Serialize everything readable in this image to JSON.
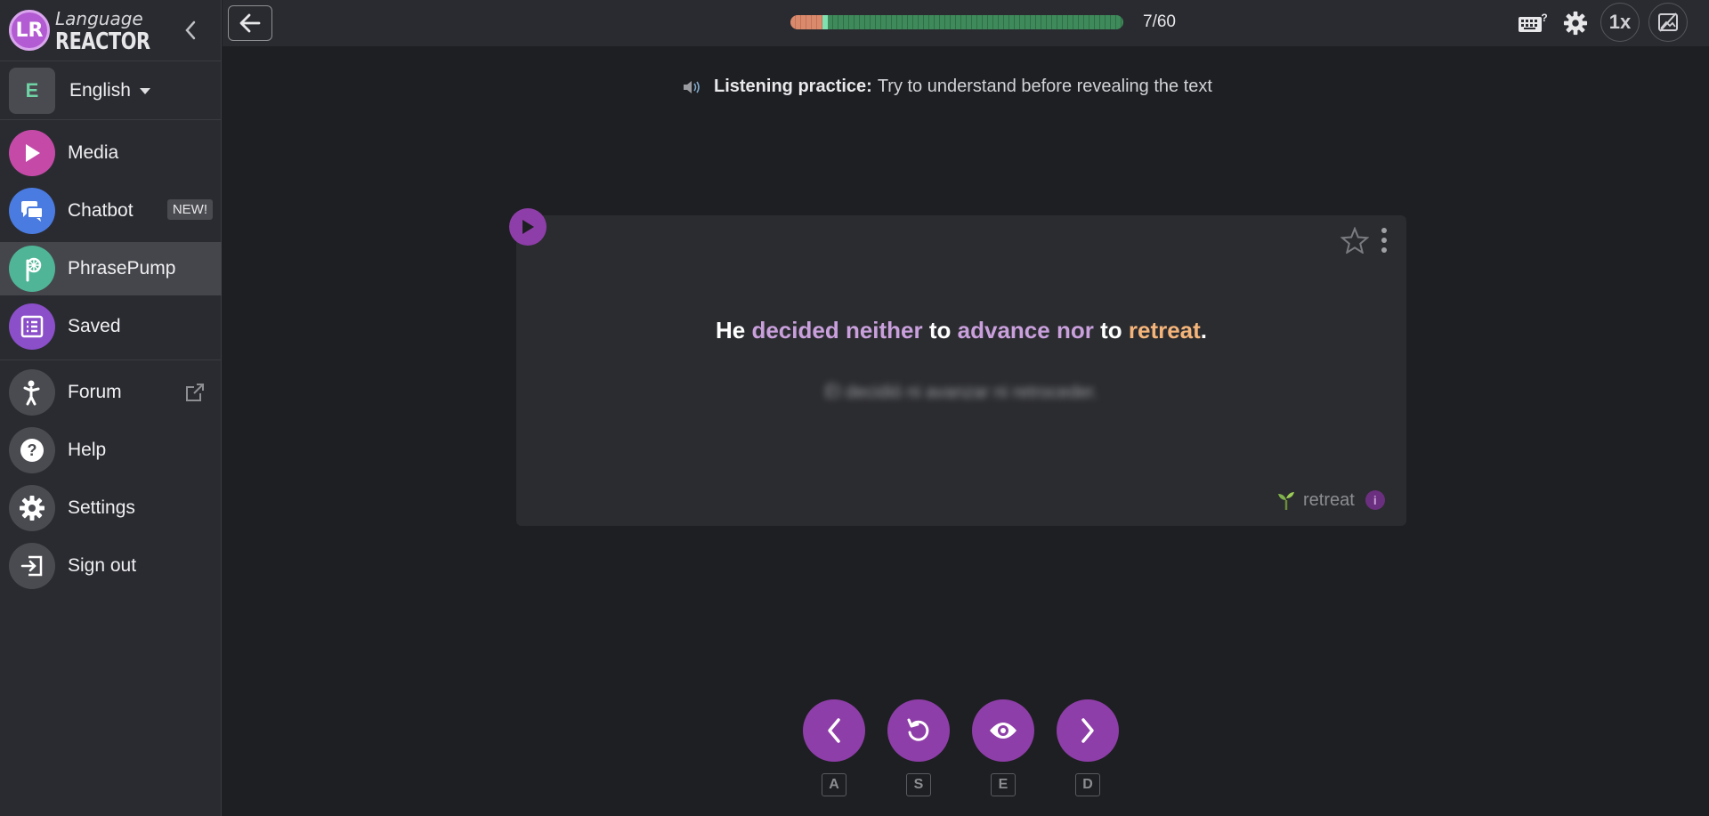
{
  "app": {
    "logo_text_top": "Language",
    "logo_text_bottom": "REACTOR",
    "logo_letters": "LR"
  },
  "sidebar": {
    "language": {
      "badge": "E",
      "label": "English"
    },
    "items": [
      {
        "label": "Media",
        "icon": "play-icon",
        "color": "#c54aa8"
      },
      {
        "label": "Chatbot",
        "icon": "chat-icon",
        "color": "#4a7be0",
        "badge": "NEW!"
      },
      {
        "label": "PhrasePump",
        "icon": "phrasepump-icon",
        "color": "#4fb596",
        "active": true
      },
      {
        "label": "Saved",
        "icon": "list-icon",
        "color": "#8a4fc9"
      },
      {
        "label": "Forum",
        "icon": "person-icon",
        "color": "#4a4b50",
        "external": true
      },
      {
        "label": "Help",
        "icon": "help-icon",
        "color": "#4a4b50"
      },
      {
        "label": "Settings",
        "icon": "gear-icon",
        "color": "#4a4b50"
      },
      {
        "label": "Sign out",
        "icon": "sign-out-icon",
        "color": "#4a4b50"
      }
    ]
  },
  "topbar": {
    "progress_text": "7/60",
    "progress": {
      "done": 7,
      "total": 60
    },
    "speed": "1x"
  },
  "main": {
    "hint_bold": "Listening practice:",
    "hint_text": "Try to understand before revealing the text",
    "sentence": [
      {
        "t": "He",
        "c": "plain"
      },
      {
        "t": "decided",
        "c": "purple"
      },
      {
        "t": "neither",
        "c": "purple"
      },
      {
        "t": "to",
        "c": "plain"
      },
      {
        "t": "advance",
        "c": "purple"
      },
      {
        "t": "nor",
        "c": "purple"
      },
      {
        "t": "to",
        "c": "plain"
      },
      {
        "t": "retreat",
        "c": "orange"
      },
      {
        "t": ".",
        "c": "plain"
      }
    ],
    "blurred_translation": "Él decidió ni avanzar ni retroceder.",
    "tag_word": "retreat",
    "info_glyph": "i"
  },
  "controls": [
    {
      "name": "prev",
      "key": "A"
    },
    {
      "name": "replay",
      "key": "S"
    },
    {
      "name": "reveal",
      "key": "E"
    },
    {
      "name": "next",
      "key": "D"
    }
  ],
  "colors": {
    "accent": "#8e3ea8",
    "background": "#1e1f23",
    "panel": "#2a2b30"
  }
}
